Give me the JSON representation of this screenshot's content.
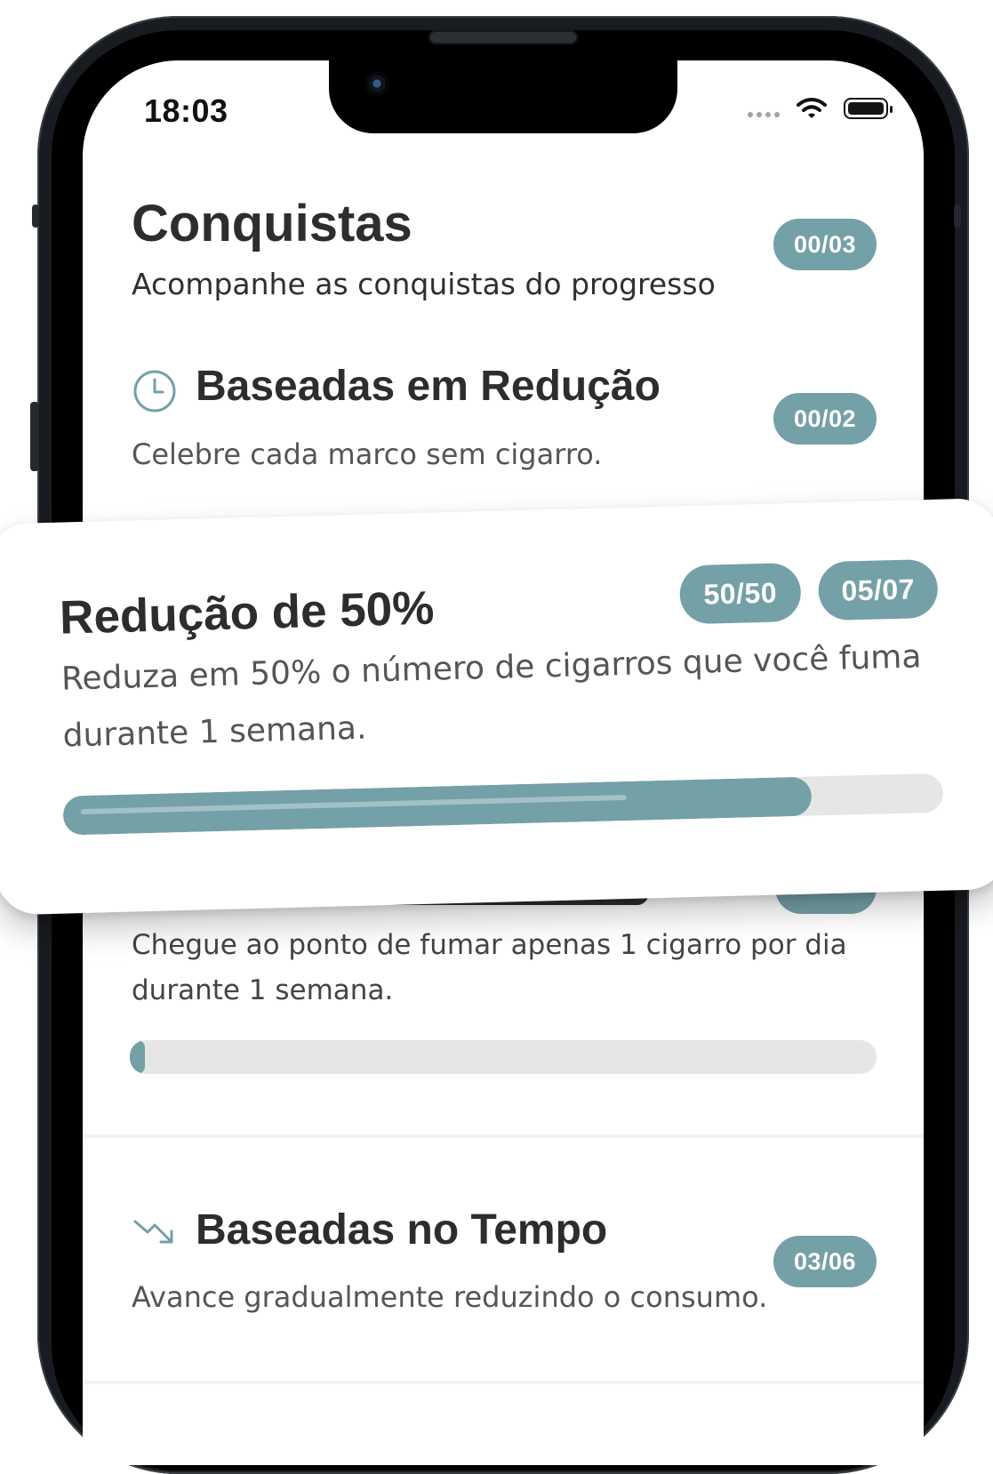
{
  "status_bar": {
    "time": "18:03",
    "icons": [
      "signal-icon",
      "wifi-icon",
      "battery-icon"
    ]
  },
  "header": {
    "title": "Conquistas",
    "subtitle": "Acompanhe as conquistas do progresso",
    "counter": "00/03"
  },
  "sections": [
    {
      "title": "Baseadas em Redução",
      "description": "Celebre cada marco sem cigarro.",
      "counter": "00/02",
      "icon": "clock-icon"
    },
    {
      "title": "Baseadas no Tempo",
      "description": "Avance gradualmente reduzindo o consumo.",
      "counter": "03/06",
      "icon": "trend-down-icon"
    }
  ],
  "achievement_card": {
    "description": "Chegue ao ponto de fumar apenas 1 cigarro por dia durante 1 semana.",
    "progress": 0.02
  },
  "floating_card": {
    "title": "Redução de 50%",
    "badge_percent": "50/50",
    "badge_days": "05/07",
    "description": "Reduza em 50% o número de cigarros que você fuma durante 1 semana.",
    "progress": 0.85
  },
  "colors": {
    "accent": "#74a0a7",
    "track": "#e6e6e6",
    "title": "#2d2d2d",
    "body": "#555555"
  }
}
